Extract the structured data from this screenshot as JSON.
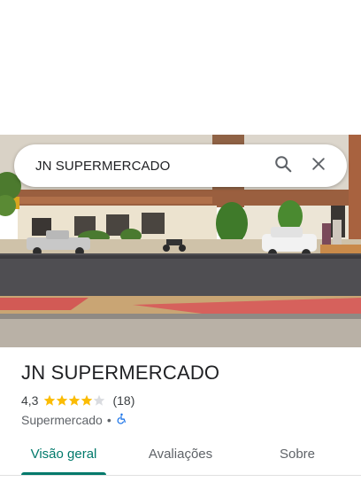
{
  "search": {
    "query": "JN SUPERMERCADO",
    "search_icon": "search-icon",
    "clear_icon": "close-icon"
  },
  "place": {
    "name": "JN SUPERMERCADO",
    "rating": "4,3",
    "rating_value": 4.3,
    "review_count": "(18)",
    "category": "Supermercado",
    "separator": "•",
    "accessibility_icon": "wheelchair-icon"
  },
  "tabs": [
    {
      "label": "Visão geral",
      "active": true
    },
    {
      "label": "Avaliações",
      "active": false
    },
    {
      "label": "Sobre",
      "active": false
    }
  ],
  "colors": {
    "accent": "#00796b",
    "star": "#fbbc04",
    "accessibility": "#1a73e8"
  }
}
